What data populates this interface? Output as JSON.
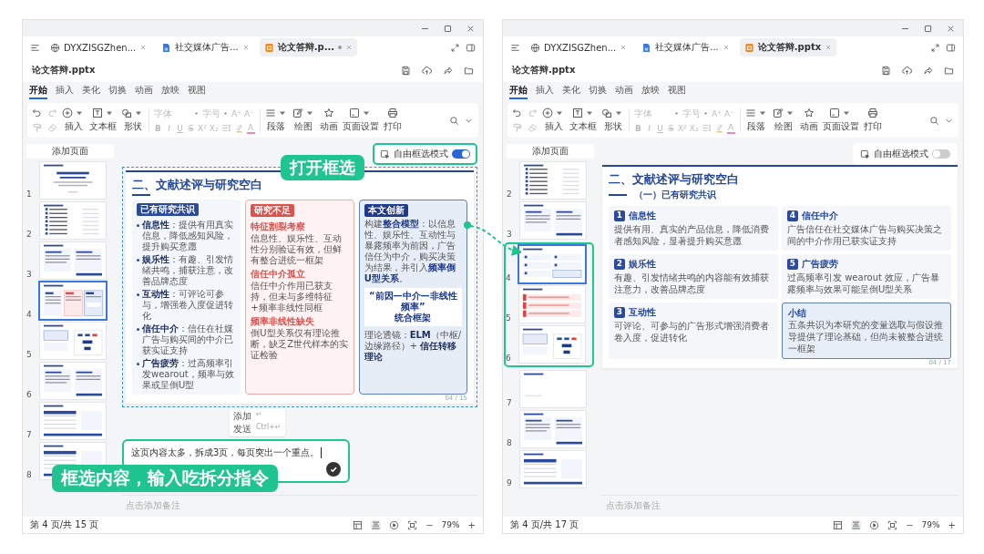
{
  "windows": [
    {
      "tabs": [
        {
          "label": "DYXZISGZhen...",
          "selected": false,
          "unsaved": false
        },
        {
          "label": "社交媒体广告...",
          "selected": false,
          "unsaved": false
        },
        {
          "label": "论文答辩.p...",
          "selected": true,
          "unsaved": true
        }
      ],
      "file_name": "论文答辩.pptx",
      "ribbon_tabs": [
        {
          "label": "开始",
          "selected": true
        },
        {
          "label": "插入",
          "selected": false
        },
        {
          "label": "美化",
          "selected": false
        },
        {
          "label": "切换",
          "selected": false
        },
        {
          "label": "动画",
          "selected": false
        },
        {
          "label": "放映",
          "selected": false
        },
        {
          "label": "视图",
          "selected": false
        }
      ],
      "toolbar": {
        "insert": [
          {
            "label": "插入"
          },
          {
            "label": "文本框"
          },
          {
            "label": "形状"
          }
        ],
        "font": "字体",
        "size": "字号",
        "size_buttons": [
          "A⁺",
          "A⁻"
        ],
        "format_buttons": [
          "B",
          "I",
          "U",
          "S",
          "X²",
          "X₂"
        ],
        "color_button": "A",
        "tools": [
          {
            "label": "段落"
          },
          {
            "label": "绘图"
          },
          {
            "label": "动画"
          },
          {
            "label": "页面设置"
          },
          {
            "label": "打印"
          }
        ]
      },
      "add_page": "添加页面",
      "thumbnails": [
        {
          "number": "1",
          "kind": "title",
          "selected": false,
          "highlighted": false
        },
        {
          "number": "2",
          "kind": "list",
          "selected": false,
          "highlighted": false
        },
        {
          "number": "3",
          "kind": "columns",
          "selected": false,
          "highlighted": false
        },
        {
          "number": "4",
          "kind": "three",
          "selected": true,
          "highlighted": false
        },
        {
          "number": "5",
          "kind": "diagram",
          "selected": false,
          "highlighted": false
        },
        {
          "number": "6",
          "kind": "columns",
          "selected": false,
          "highlighted": false
        },
        {
          "number": "7",
          "kind": "table",
          "selected": false,
          "highlighted": false
        },
        {
          "number": "8",
          "kind": "table",
          "selected": false,
          "highlighted": false
        }
      ],
      "free_select": {
        "label": "自由框选模式",
        "on": true,
        "highlighted": true
      },
      "slide": {
        "selected_region": true,
        "title": "二、文献述评与研究空白",
        "page": "04 / 15",
        "columns": [
          {
            "kind": "consensus",
            "badge": "已有研究共识",
            "bullets": [
              "**信息性**：提供有用真实信息，降低感知风险，提升购买意愿",
              "**娱乐性**：有趣、引发情绪共鸣，捕获注意，改善品牌态度",
              "**互动性**：可评论可参与，增强卷入度促进转化",
              "**信任中介**：信任在社媒广告与购买间的中介已获实证支持",
              "**广告疲劳**：过高频率引发wearout，频率与效果或呈倒U型"
            ]
          },
          {
            "kind": "gaps",
            "badge": "研究不足",
            "items": [
              {
                "heading": "特征割裂考察",
                "text": "信息性、娱乐性、互动性分别验证有效，但鲜有整合进统一框架"
              },
              {
                "heading": "信任中介孤立",
                "text": "信任中介作用已获支持，但未与多维特征+频率非线性同框"
              },
              {
                "heading": "频率非线性缺失",
                "text": "倒U型关系仅有理论推断，缺乏Z世代样本的实证检验"
              }
            ]
          },
          {
            "kind": "innovation",
            "badge": "本文创新",
            "text": "构建**整合模型**：以信息性、娱乐性、互动性与暴露频率为前因，广告信任为中介，购买决策为结果，并引入**频率倒U型关系**。",
            "framework": [
              "“前因—中介—非线性频率”",
              "统合框架"
            ],
            "theory": "理论透镜：**ELM**（中枢/边缘路径）+ **信任转移理论**"
          }
        ]
      },
      "chat": {
        "text": "这页内容太多，拆成3页，每页突出一个重点。",
        "highlighted": true,
        "hints": [
          {
            "label": "添加",
            "key": "↵"
          },
          {
            "label": "发送",
            "key": "Ctrl+↵"
          }
        ]
      },
      "notes_placeholder": "点击添加备注",
      "status": {
        "page": "第 4 页/共 15 页",
        "zoom_out": "−",
        "zoom": "79%",
        "zoom_in": "+"
      }
    },
    {
      "tabs": [
        {
          "label": "DYXZISGZhen...",
          "selected": false,
          "unsaved": false
        },
        {
          "label": "社交媒体广告...",
          "selected": false,
          "unsaved": false
        },
        {
          "label": "论文答辩.pptx",
          "selected": true,
          "unsaved": false
        }
      ],
      "file_name": "论文答辩.pptx",
      "ribbon_tabs": [
        {
          "label": "开始",
          "selected": true
        },
        {
          "label": "插入",
          "selected": false
        },
        {
          "label": "美化",
          "selected": false
        },
        {
          "label": "切换",
          "selected": false
        },
        {
          "label": "动画",
          "selected": false
        },
        {
          "label": "放映",
          "selected": false
        },
        {
          "label": "视图",
          "selected": false
        }
      ],
      "toolbar": {
        "insert": [
          {
            "label": "插入"
          },
          {
            "label": "文本框"
          },
          {
            "label": "形状"
          }
        ],
        "font": "字体",
        "size": "字号",
        "size_buttons": [
          "A⁺",
          "A⁻"
        ],
        "format_buttons": [
          "B",
          "I",
          "U",
          "S",
          "X²",
          "X₂"
        ],
        "color_button": "A",
        "tools": [
          {
            "label": "段落"
          },
          {
            "label": "绘图"
          },
          {
            "label": "动画"
          },
          {
            "label": "页面设置"
          },
          {
            "label": "打印"
          }
        ]
      },
      "add_page": "添加页面",
      "thumbnails": [
        {
          "number": "2",
          "kind": "list",
          "selected": false,
          "highlighted": false
        },
        {
          "number": "3",
          "kind": "columns",
          "selected": false,
          "highlighted": false
        },
        {
          "number": "4",
          "kind": "cards",
          "selected": true,
          "highlighted": true
        },
        {
          "number": "5",
          "kind": "rows",
          "selected": false,
          "highlighted": true
        },
        {
          "number": "6",
          "kind": "diagram",
          "selected": false,
          "highlighted": true
        },
        {
          "number": "7",
          "kind": "blank",
          "selected": false,
          "highlighted": false
        },
        {
          "number": "8",
          "kind": "columns",
          "selected": false,
          "highlighted": false
        },
        {
          "number": "9",
          "kind": "table",
          "selected": false,
          "highlighted": false
        }
      ],
      "free_select": {
        "label": "自由框选模式",
        "on": false,
        "highlighted": false
      },
      "slide": {
        "selected_region": false,
        "title": "二、文献述评与研究空白",
        "subtitle": "（一）已有研究共识",
        "page": "04 / 17",
        "cards": [
          {
            "number": "1",
            "heading": "信息性",
            "text": "提供有用、真实的产品信息，降低消费者感知风险，显著提升购买意愿"
          },
          {
            "number": "2",
            "heading": "娱乐性",
            "text": "有趣、引发情绪共鸣的内容能有效捕获注意力，改善品牌态度"
          },
          {
            "number": "3",
            "heading": "互动性",
            "text": "可评论、可参与的广告形式增强消费者卷入度，促进转化"
          },
          {
            "number": "4",
            "heading": "信任中介",
            "text": "广告信任在社交媒体广告与购买决策之间的中介作用已获实证支持"
          },
          {
            "number": "5",
            "heading": "广告疲劳",
            "text": "过高频率引发 wearout 效应，广告暴露频率与效果可能呈倒U型关系"
          }
        ],
        "summary": {
          "heading": "小结",
          "text": "五条共识为本研究的变量选取与假设推导提供了理论基础，但尚未被整合进统一框架"
        }
      },
      "notes_placeholder": "点击添加备注",
      "status": {
        "page": "第 4 页/共 17 页",
        "zoom_out": "−",
        "zoom": "79%",
        "zoom_in": "+"
      }
    }
  ],
  "annotations": [
    {
      "kind": "toggle-callout",
      "text": "打开框选"
    },
    {
      "kind": "input-callout",
      "text": "框选内容，输入吃拆分指令"
    },
    {
      "kind": "connector"
    }
  ]
}
